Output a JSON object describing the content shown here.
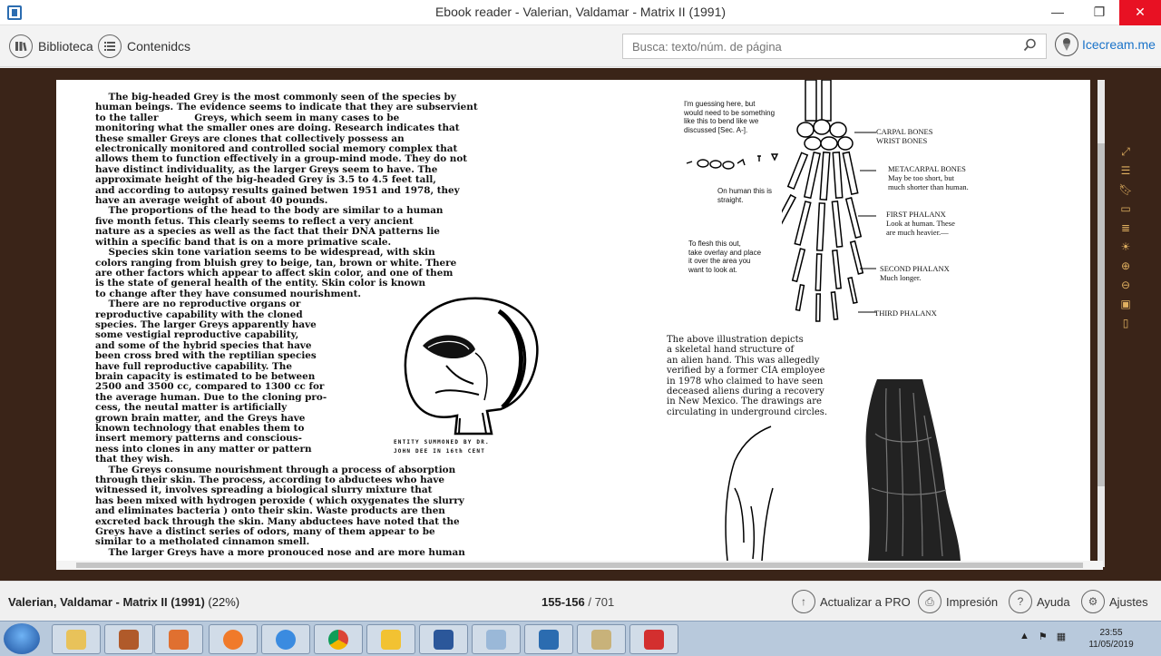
{
  "window": {
    "title": "Ebook reader - Valerian, Valdamar - Matrix II (1991)",
    "minimize": "—",
    "restore": "❐",
    "close": "✕"
  },
  "toolbar": {
    "library_label": "Biblioteca",
    "contents_label": "Contenidcs",
    "search_placeholder": "Busca: texto/núm. de página",
    "brand_label": "Icecream.me"
  },
  "book": {
    "left_text": "    The big-headed Grey is the most commonly seen of the species by\nhuman beings. The evidence seems to indicate that they are subservient\nto the taller           Greys, which seem in many cases to be\nmonitoring what the smaller ones are doing. Research indicates that\nthese smaller Greys are clones that collectively possess an\nelectronically monitored and controlled social memory complex that\nallows them to function effectively in a group-mind mode. They do not\nhave distinct individuality, as the larger Greys seem to have. The\napproximate height of the big-headed Grey is 3.5 to 4.5 feet tall,\nand according to autopsy results gained betwen 1951 and 1978, they\nhave an average weight of about 40 pounds.\n    The proportions of the head to the body are similar to a human\nfive month fetus. This clearly seems to reflect a very ancient\nnature as a species as well as the fact that their DNA patterns lie\nwithin a specific band that is on a more primative scale.\n    Species skin tone variation seems to be widespread, with skin\ncolors ranging from bluish grey to beige, tan, brown or white. There\nare other factors which appear to affect skin color, and one of them\nis the state of general health of the entity. Skin color is known\nto change after they have consumed nourishment.\n    There are no reproductive organs or\nreproductive capability with the cloned\nspecies. The larger Greys apparently have\nsome vestigial reproductive capability,\nand some of the hybrid species that have\nbeen cross bred with the reptilian species\nhave full reproductive capability. The\nbrain capacity is estimated to be between\n2500 and 3500 cc, compared to 1300 cc for\nthe average human. Due to the cloning pro-\ncess, the neutal matter is artificially\ngrown brain matter, and the Greys have\nknown technology that enables them to\ninsert memory patterns and conscious-\nness into clones in any matter or pattern\nthat they wish.\n    The Greys consume nourishment through a process of absorption\nthrough their skin. The process, according to abductees who have\nwitnessed it, involves spreading a biological slurry mixture that\nhas been mixed with hydrogen peroxide ( which oxygenates the slurry\nand eliminates bacteria ) onto their skin. Waste products are then\nexcreted back through the skin. Many abductees have noted that the\nGreys have a distinct series of odors, many of them appear to be\nsimilar to a metholated cinnamon smell.\n    The larger Greys have a more pronouced nose and are more human",
    "image_caption": "ENTITY SUMMONED BY DR.\nJOHN DEE IN 16th CENT",
    "note_top": "I'm guessing here, but\nwould need to be something\nlike this to bend like we\ndiscussed [Sec. A-].",
    "note_straight": "On human this is\nstraight.",
    "note_flesh": "To flesh this out,\ntake overlay and place\nit over the area you\nwant to look at.",
    "label_carpal": "CARPAL BONES\nWRIST BONES",
    "label_metacarpal": "METACARPAL BONES\nMay be too short, but\nmuch shorter than human.",
    "label_first": "FIRST PHALANX\nLook at human. These\nare much heavier.—",
    "label_second": "SECOND PHALANX\nMuch longer.",
    "label_third": "THIRD PHALANX",
    "right_caption": "The above illustration depicts\na skeletal hand structure of\nan alien hand. This was allegedly\nverified by a former CIA employee\nin 1978 who claimed to have seen\ndeceased aliens during a recovery\nin New Mexico. The drawings are\ncirculating in underground circles."
  },
  "status": {
    "book_title": "Valerian, Valdamar - Matrix II (1991)",
    "percent": "(22%)",
    "pages_current": "155-156",
    "pages_total": "/ 701",
    "upgrade_label": "Actualizar a PRO",
    "print_label": "Impresión",
    "help_label": "Ayuda",
    "settings_label": "Ajustes"
  },
  "taskbar": {
    "time": "23:55",
    "date": "11/05/2019"
  },
  "colors": {
    "reader_bg": "#3a2418",
    "accent": "#1a73c9",
    "close": "#e81123"
  }
}
